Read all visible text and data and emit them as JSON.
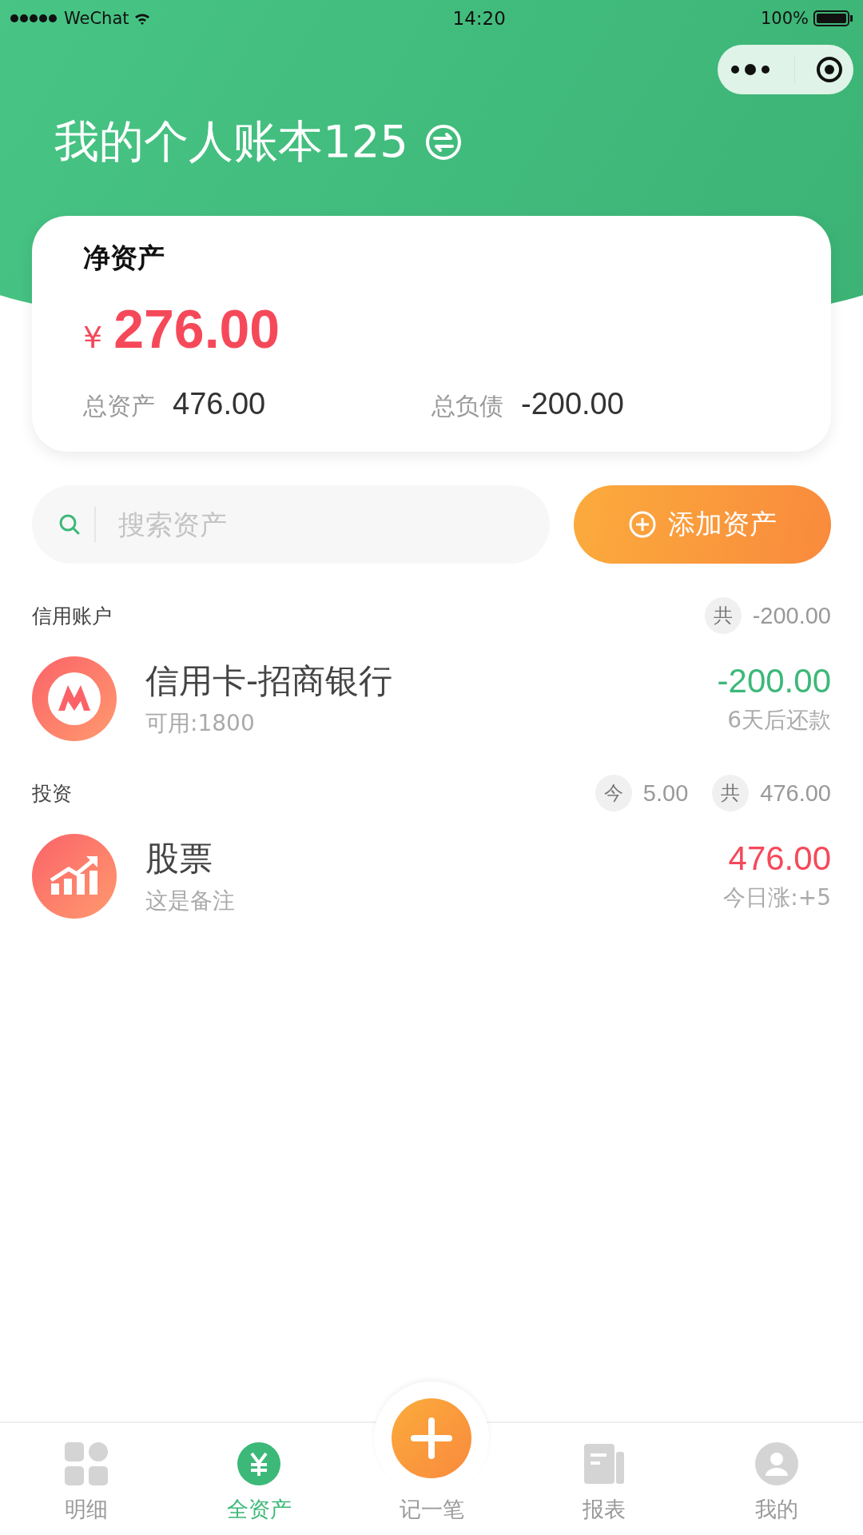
{
  "status_bar": {
    "carrier": "WeChat",
    "time": "14:20",
    "battery": "100%"
  },
  "header": {
    "title": "我的个人账本125"
  },
  "summary": {
    "label": "净资产",
    "currency": "¥",
    "net": "276.00",
    "total_assets_label": "总资产",
    "total_assets": "476.00",
    "total_liabilities_label": "总负债",
    "total_liabilities": "-200.00"
  },
  "search": {
    "placeholder": "搜索资产"
  },
  "add_button": "添加资产",
  "groups": [
    {
      "title": "信用账户",
      "totals": [
        {
          "tag": "共",
          "value": "-200.00"
        }
      ],
      "accounts": [
        {
          "kind": "bank",
          "name": "信用卡-招商银行",
          "note": "可用:1800",
          "amount": "-200.00",
          "color": "#3cb878",
          "sub": "6天后还款"
        }
      ]
    },
    {
      "title": "投资",
      "totals": [
        {
          "tag": "今",
          "value": "5.00"
        },
        {
          "tag": "共",
          "value": "476.00"
        }
      ],
      "accounts": [
        {
          "kind": "stock",
          "name": "股票",
          "note": "这是备注",
          "amount": "476.00",
          "color": "#f5495a",
          "sub": "今日涨:+5"
        }
      ]
    }
  ],
  "tabbar": [
    {
      "kind": "grid",
      "label": "明细",
      "selected": false
    },
    {
      "kind": "yuan",
      "label": "全资产",
      "selected": true
    },
    {
      "kind": "add",
      "label": "记一笔",
      "selected": false
    },
    {
      "kind": "report",
      "label": "报表",
      "selected": false
    },
    {
      "kind": "user",
      "label": "我的",
      "selected": false
    }
  ]
}
